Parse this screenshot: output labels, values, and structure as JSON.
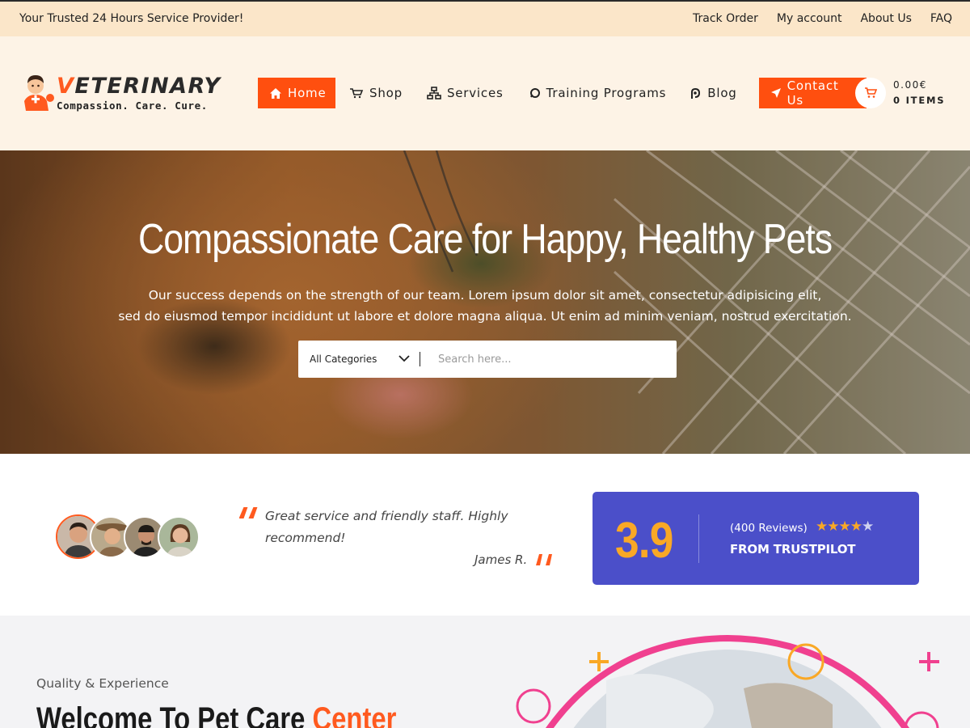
{
  "topbar": {
    "tagline": "Your Trusted 24 Hours Service Provider!",
    "links": [
      "Track Order",
      "My account",
      "About Us",
      "FAQ"
    ]
  },
  "brand": {
    "logo_letter": "V",
    "logo_rest": "ETERINARY",
    "slogan": "Compassion. Care. Cure.",
    "accent_color": "#ff4f0f"
  },
  "nav": {
    "home": "Home",
    "shop": "Shop",
    "services": "Services",
    "training": "Training Programs",
    "blog": "Blog",
    "contact": "Contact Us"
  },
  "cart": {
    "amount": "0.00€",
    "items": "0 ITEMS"
  },
  "hero": {
    "title": "Compassionate Care for Happy, Healthy Pets",
    "subtitle_line1": "Our success depends on the strength of our team. Lorem ipsum dolor sit amet, consectetur adipisicing elit,",
    "subtitle_line2": "sed do eiusmod tempor incididunt ut labore et dolore magna aliqua. Ut enim ad minim veniam, nostrud exercitation.",
    "category_selected": "All Categories",
    "search_placeholder": "Search here..."
  },
  "testimonial": {
    "quote": "Great service and friendly staff. Highly recommend!",
    "author": "James R."
  },
  "rating": {
    "score": "3.9",
    "reviews": "(400 Reviews)",
    "source": "FROM TRUSTPILOT",
    "stars_filled": 4,
    "stars_total": 5,
    "card_color": "#4b4fc9",
    "score_color": "#f9a826"
  },
  "about": {
    "kicker": "Quality & Experience",
    "title_main": "Welcome To Pet Care",
    "title_accent": "Center"
  }
}
